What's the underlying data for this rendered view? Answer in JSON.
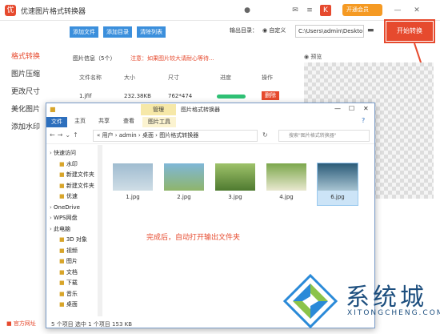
{
  "app": {
    "title": "优速图片格式转换器",
    "vip_label": "开通会员",
    "start_label": "开始转换"
  },
  "sidebar": {
    "items": [
      {
        "label": "格式转换",
        "active": true
      },
      {
        "label": "图片压缩"
      },
      {
        "label": "更改尺寸"
      },
      {
        "label": "美化图片"
      },
      {
        "label": "添加水印"
      }
    ],
    "footer": "官方网址"
  },
  "toolbar": {
    "add_file": "添加文件",
    "add_dir": "添加目录",
    "clear_list": "清除列表",
    "output_label": "输出目录：",
    "custom_label": "自定义",
    "output_path": "C:\\Users\\admin\\Deskto"
  },
  "table": {
    "info": "图片信息（5个）",
    "warn": "注意：如果图片较大请耐心等待...",
    "headers": [
      "文件名称",
      "大小",
      "尺寸",
      "进度",
      "操作"
    ],
    "row": {
      "name": "1.jfif",
      "size": "232.38KB",
      "dim": "762*474",
      "action": "删除"
    }
  },
  "preview": {
    "label": "预览"
  },
  "explorer": {
    "title": "图片格式转换器",
    "manage_tab": "管理",
    "tabs": [
      "文件",
      "主页",
      "共享",
      "查看",
      "图片工具"
    ],
    "path": [
      "用户",
      "admin",
      "桌面",
      "图片格式转换器"
    ],
    "search_placeholder": "搜索\"图片格式转换器\"",
    "nav": [
      {
        "label": "快速访问",
        "level": 0
      },
      {
        "label": "水印",
        "level": 1
      },
      {
        "label": "新建文件夹",
        "level": 1
      },
      {
        "label": "新建文件夹",
        "level": 1
      },
      {
        "label": "优速",
        "level": 1
      },
      {
        "label": "OneDrive",
        "level": 0
      },
      {
        "label": "WPS网盘",
        "level": 0
      },
      {
        "label": "此电脑",
        "level": 0
      },
      {
        "label": "3D 对象",
        "level": 1
      },
      {
        "label": "视频",
        "level": 1
      },
      {
        "label": "图片",
        "level": 1
      },
      {
        "label": "文档",
        "level": 1
      },
      {
        "label": "下载",
        "level": 1
      },
      {
        "label": "音乐",
        "level": 1
      },
      {
        "label": "桌面",
        "level": 1
      }
    ],
    "files": [
      {
        "name": "1.jpg",
        "colors": [
          "#9fbcd0",
          "#cfdde6"
        ]
      },
      {
        "name": "2.jpg",
        "colors": [
          "#7fb7d8",
          "#8fb56a"
        ]
      },
      {
        "name": "3.jpg",
        "colors": [
          "#9ec26a",
          "#4f7a30"
        ]
      },
      {
        "name": "4.jpg",
        "colors": [
          "#7ca74c",
          "#e9e8d0"
        ]
      },
      {
        "name": "6.jpg",
        "colors": [
          "#2b5b78",
          "#a8c4d2"
        ],
        "selected": true
      }
    ],
    "status": "5 个项目    选中 1 个项目  153 KB",
    "note": "完成后，自动打开输出文件夹"
  },
  "watermark": {
    "main": "系统城",
    "sub": "XITONGCHENG.COM"
  }
}
